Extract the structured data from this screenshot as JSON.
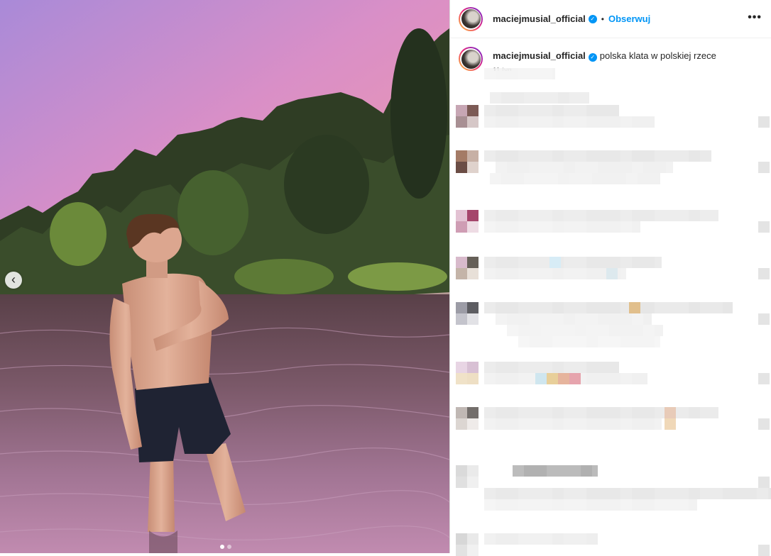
{
  "post": {
    "username": "maciejmusial_official",
    "follow_label": "Obserwuj",
    "separator": "•",
    "more_label": "•••",
    "caption": "polska klata w polskiej rzece",
    "time_ago": "11 tyg."
  },
  "carousel": {
    "prev_label": "‹",
    "slides": 2,
    "active_slide": 1
  },
  "icons": {
    "verified": "verified-badge-icon",
    "more": "more-options-icon",
    "prev": "chevron-left-icon"
  },
  "colors": {
    "accent": "#0095f6",
    "sky_top": "#b58ad6",
    "sky_bottom": "#ee93b5",
    "water": "#7a5d6e"
  }
}
